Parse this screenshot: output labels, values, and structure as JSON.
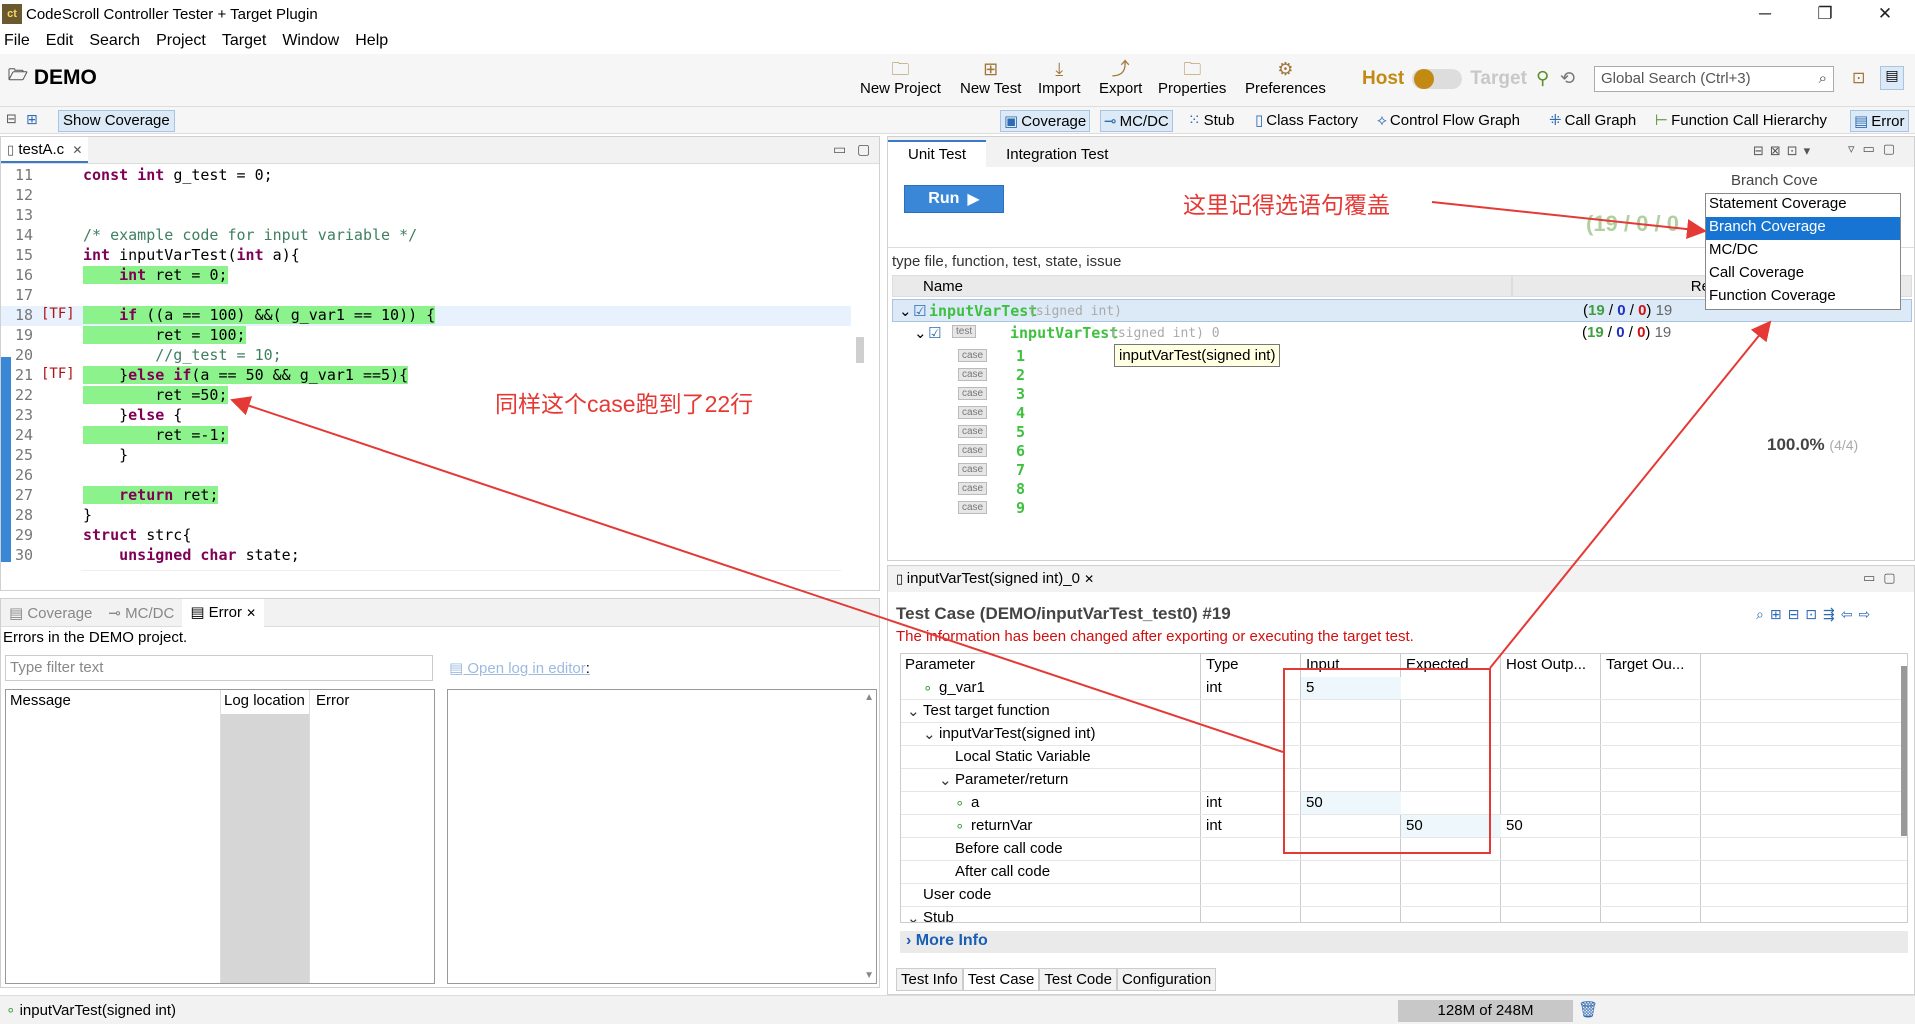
{
  "window": {
    "title": "CodeScroll Controller Tester + Target Plugin",
    "minimize": "─",
    "maximize": "❐",
    "close": "✕"
  },
  "menu": [
    "File",
    "Edit",
    "Search",
    "Project",
    "Target",
    "Window",
    "Help"
  ],
  "toolbar": {
    "project_name": "DEMO",
    "buttons": [
      "New Project",
      "New Test",
      "Import",
      "Export",
      "Properties",
      "Preferences"
    ],
    "host_label": "Host",
    "target_label": "Target",
    "search_placeholder": "Global Search (Ctrl+3)"
  },
  "subtoolbar": {
    "show_coverage": "Show Coverage",
    "views": [
      "Coverage",
      "MC/DC",
      "Stub",
      "Class Factory",
      "Control Flow Graph",
      "Call Graph",
      "Function Call Hierarchy",
      "Error"
    ]
  },
  "editor": {
    "tab": "testA.c",
    "lines": [
      {
        "n": "11",
        "marker": "",
        "text": "const int g_test = 0;",
        "hl": false
      },
      {
        "n": "12",
        "marker": "",
        "text": "",
        "hl": false
      },
      {
        "n": "13",
        "marker": "",
        "text": "",
        "hl": false
      },
      {
        "n": "14",
        "marker": "",
        "text": "/* example code for input variable */",
        "hl": false
      },
      {
        "n": "15",
        "marker": "",
        "text": "int inputVarTest(int a){",
        "hl": false
      },
      {
        "n": "16",
        "marker": "",
        "text": "    int ret = 0;",
        "hl": true
      },
      {
        "n": "17",
        "marker": "",
        "text": "",
        "hl": false
      },
      {
        "n": "18",
        "marker": "[TF]",
        "text": "    if ((a == 100) &&( g_var1 == 10)) {",
        "hl": true
      },
      {
        "n": "19",
        "marker": "",
        "text": "        ret = 100;",
        "hl": true
      },
      {
        "n": "20",
        "marker": "",
        "text": "        //g_test = 10;",
        "hl": false
      },
      {
        "n": "21",
        "marker": "[TF]",
        "text": "    }else if(a == 50 && g_var1 ==5){",
        "hl": true
      },
      {
        "n": "22",
        "marker": "",
        "text": "        ret =50;",
        "hl": true
      },
      {
        "n": "23",
        "marker": "",
        "text": "    }else {",
        "hl": false
      },
      {
        "n": "24",
        "marker": "",
        "text": "        ret =-1;",
        "hl": true
      },
      {
        "n": "25",
        "marker": "",
        "text": "    }",
        "hl": false
      },
      {
        "n": "26",
        "marker": "",
        "text": "",
        "hl": false
      },
      {
        "n": "27",
        "marker": "",
        "text": "    return ret;",
        "hl": true
      },
      {
        "n": "28",
        "marker": "",
        "text": "}",
        "hl": false
      },
      {
        "n": "29",
        "marker": "",
        "text": "struct strc{",
        "hl": false
      },
      {
        "n": "30",
        "marker": "",
        "text": "    unsigned char state;",
        "hl": false
      }
    ]
  },
  "errors": {
    "tabs": [
      "Coverage",
      "MC/DC",
      "Error"
    ],
    "note": "Errors in the DEMO project.",
    "filter_placeholder": "Type filter text",
    "open_log": "Open log in editor",
    "open_log_suffix": ":",
    "columns": [
      "Message",
      "Log location",
      "Error"
    ]
  },
  "unit": {
    "tabs": [
      "Unit Test",
      "Integration Test"
    ],
    "run": "Run",
    "run_icon": "▶",
    "coverage_numbers": "(19 / 0 / 0",
    "filter_hint": "type file, function, test, state, issue",
    "col_name": "Name",
    "col_result": "Result",
    "func_row": {
      "name": "inputVarTest",
      "sig": "(signed int)",
      "res_pass": "19",
      "res_b": "0",
      "res_r": "0",
      "res_total": "19"
    },
    "test_row": {
      "badge": "test",
      "name": "inputVarTest",
      "sig": "(signed int) 0",
      "res_pass": "19",
      "res_b": "0",
      "res_r": "0",
      "res_total": "19"
    },
    "case_badge": "case",
    "cases": [
      "1",
      "2",
      "3",
      "4",
      "5",
      "6",
      "7",
      "8",
      "9"
    ],
    "percent": "100.0%",
    "percent_ratio": "(4/4)",
    "tooltip": "inputVarTest(signed int)"
  },
  "coverage_dropdown": {
    "selected_label": "Branch Cove",
    "options": [
      "Statement Coverage",
      "Branch Coverage",
      "MC/DC",
      "Call Coverage",
      "Function Coverage"
    ],
    "highlighted": 1
  },
  "testcase": {
    "tab": "inputVarTest(signed int)_0",
    "title": "Test Case (DEMO/inputVarTest_test0) #19",
    "warning": "The information has been changed after exporting or executing the target test.",
    "columns": [
      "Parameter",
      "Type",
      "Input",
      "Expected",
      "Host Outp...",
      "Target Ou..."
    ],
    "rows": [
      {
        "indent": 1,
        "icon": "∘",
        "name": "g_var1",
        "type": "int",
        "input": "5",
        "expected": "",
        "host": ""
      },
      {
        "indent": 0,
        "icon": "⌄",
        "name": "Test target function",
        "type": "",
        "input": "",
        "expected": "",
        "host": ""
      },
      {
        "indent": 1,
        "icon": "⌄",
        "name": "inputVarTest(signed int)",
        "type": "",
        "input": "",
        "expected": "",
        "host": ""
      },
      {
        "indent": 2,
        "icon": "",
        "name": "Local Static Variable",
        "type": "",
        "input": "",
        "expected": "",
        "host": ""
      },
      {
        "indent": 2,
        "icon": "⌄",
        "name": "Parameter/return",
        "type": "",
        "input": "",
        "expected": "",
        "host": ""
      },
      {
        "indent": 3,
        "icon": "∘",
        "name": "a",
        "type": "int",
        "input": "50",
        "expected": "",
        "host": ""
      },
      {
        "indent": 3,
        "icon": "∘",
        "name": "returnVar",
        "type": "int",
        "input": "",
        "expected": "50",
        "host": "50"
      },
      {
        "indent": 2,
        "icon": "",
        "name": "Before call code",
        "type": "",
        "input": "",
        "expected": "",
        "host": ""
      },
      {
        "indent": 2,
        "icon": "",
        "name": "After call code",
        "type": "",
        "input": "",
        "expected": "",
        "host": ""
      },
      {
        "indent": 0,
        "icon": "",
        "name": "User code",
        "type": "",
        "input": "",
        "expected": "",
        "host": ""
      },
      {
        "indent": 0,
        "icon": "⌄",
        "name": "Stub",
        "type": "",
        "input": "",
        "expected": "",
        "host": ""
      }
    ],
    "more_info": "More Info",
    "bottom_tabs": [
      "Test Info",
      "Test Case",
      "Test Code",
      "Configuration"
    ]
  },
  "status": {
    "left": "inputVarTest(signed int)",
    "heap": "128M of 248M"
  },
  "annotations": {
    "statement_note": "这里记得选语句覆盖",
    "case_note": "同样这个case跑到了22行"
  },
  "colors": {
    "accent": "#3a87d8",
    "highlight": "#8cf38c",
    "annotation": "#e53935",
    "pass": "#40c040"
  }
}
